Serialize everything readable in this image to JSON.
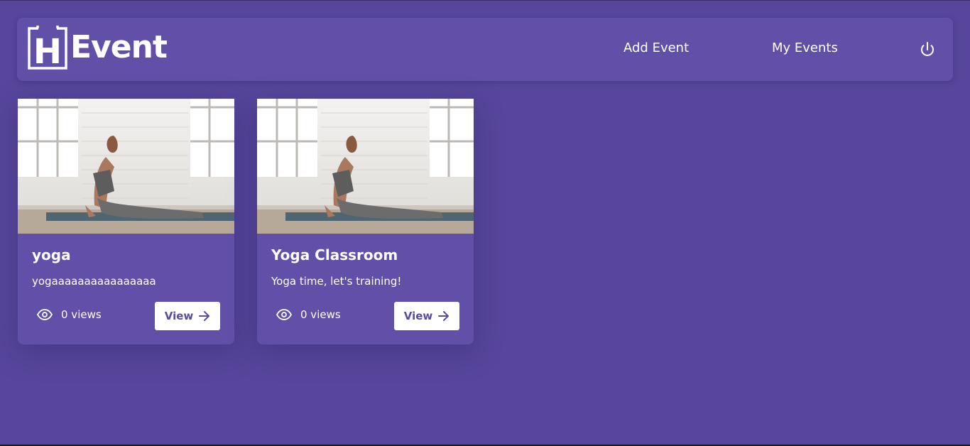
{
  "header": {
    "logo_text": "Event",
    "logo_letter": "H",
    "nav": {
      "add_event": "Add Event",
      "my_events": "My Events"
    },
    "power_icon": "power-icon"
  },
  "events": [
    {
      "title": "yoga",
      "description": "yogaaaaaaaaaaaaaaaa",
      "views_label": "0 views",
      "button_label": "View"
    },
    {
      "title": "Yoga Classroom",
      "description": "Yoga time, let's training!",
      "views_label": "0 views",
      "button_label": "View"
    }
  ],
  "colors": {
    "background": "#57469c",
    "surface": "#624fa8",
    "accent_text": "#5b4a9f"
  }
}
